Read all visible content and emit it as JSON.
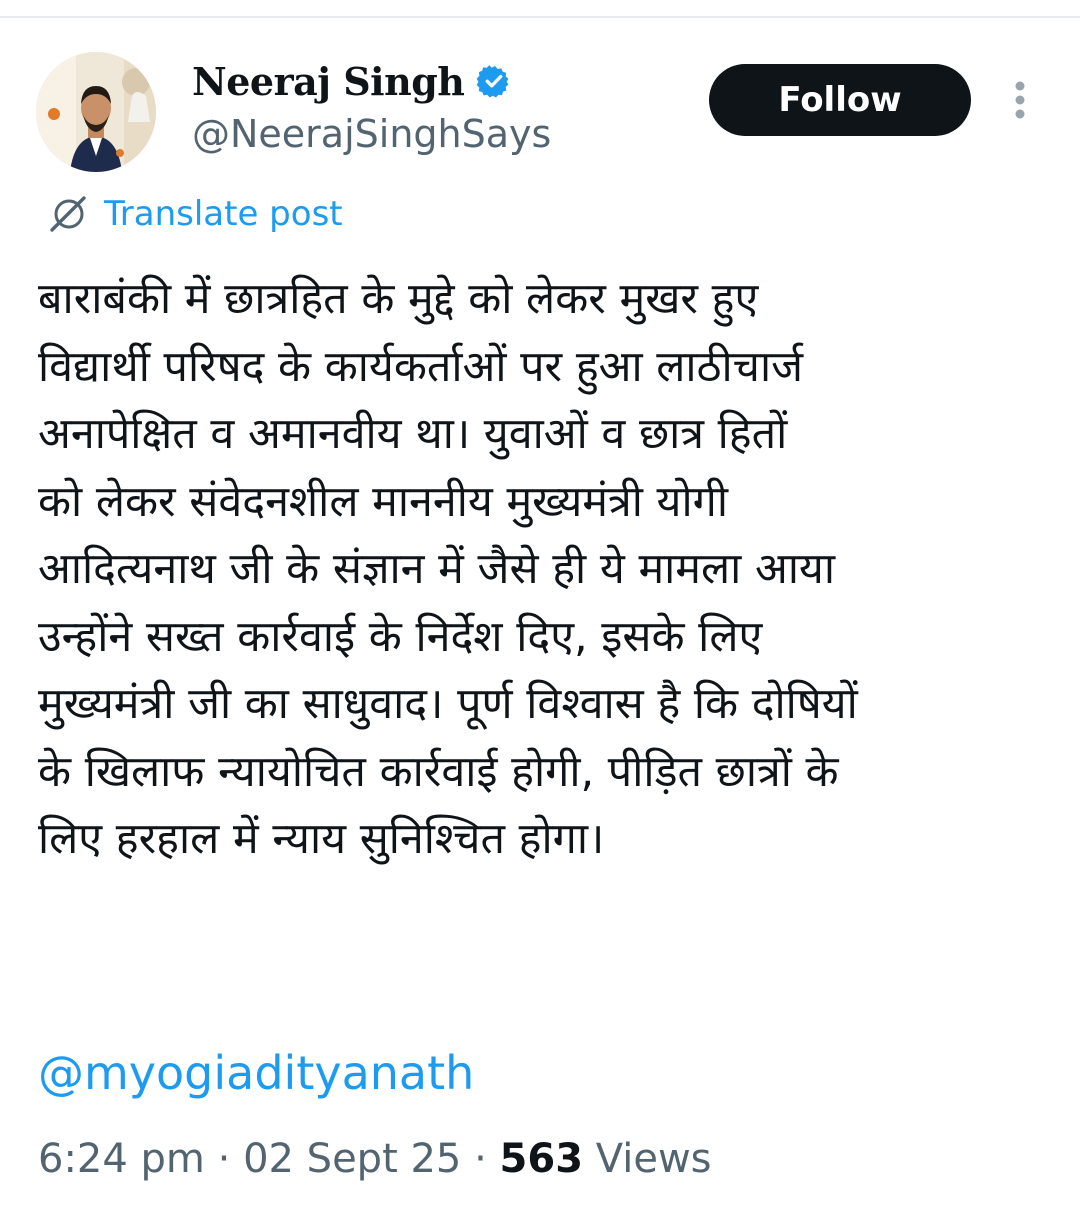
{
  "author": {
    "display_name": "Neeraj Singh",
    "handle": "@NeerajSinghSays",
    "verified": true,
    "avatar_icon": "profile-photo"
  },
  "actions": {
    "follow_label": "Follow",
    "more_icon": "vertical-ellipsis-icon"
  },
  "translate": {
    "label": "Translate post",
    "icon": "globe-slash-icon"
  },
  "post": {
    "lines": [
      "बाराबंकी में छात्रहित के मुद्दे को लेकर मुखर हुए",
      "विद्यार्थी परिषद के कार्यकर्ताओं पर हुआ लाठीचार्ज",
      "अनापेक्षित व अमानवीय था। युवाओं व छात्र हितों",
      "को लेकर संवेदनशील माननीय मुख्यमंत्री योगी",
      "आदित्यनाथ जी के संज्ञान में जैसे ही ये मामला आया",
      "उन्होंने सख्त कार्रवाई के निर्देश दिए, इसके लिए",
      "मुख्यमंत्री जी का साधुवाद। पूर्ण विश्वास है कि दोषियों",
      "के खिलाफ न्यायोचित कार्रवाई होगी, पीड़ित छात्रों के",
      "लिए हरहाल में न्याय सुनिश्चित होगा।"
    ],
    "mention": "@myogiadityanath"
  },
  "meta": {
    "time": "6:24 pm",
    "separator": "·",
    "date": "02 Sept 25",
    "views_count": "563",
    "views_label": "Views"
  },
  "colors": {
    "accent": "#1d9bf0",
    "text": "#0f1419",
    "secondary": "#536471",
    "follow_bg": "#0f1419"
  }
}
